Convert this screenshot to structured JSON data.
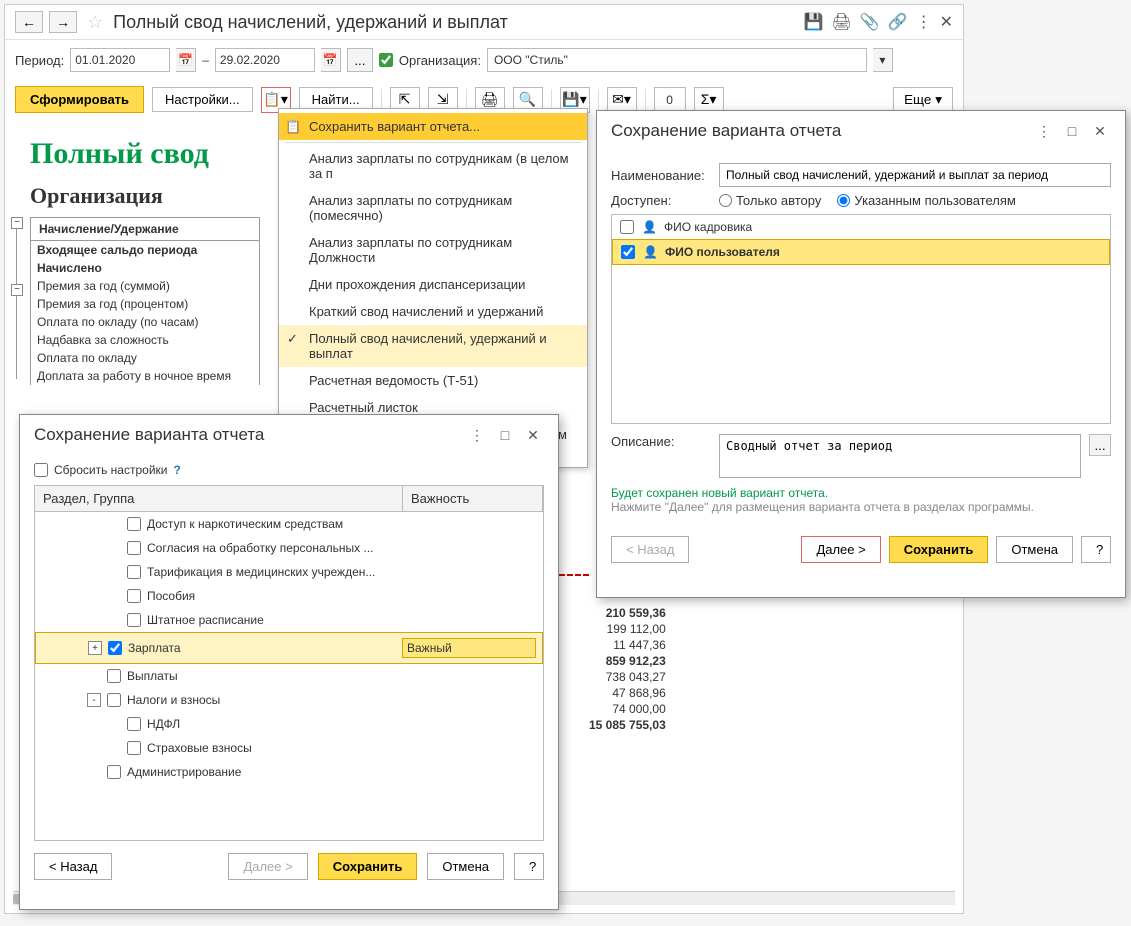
{
  "window": {
    "title": "Полный свод начислений, удержаний и выплат"
  },
  "period": {
    "label": "Период:",
    "from": "01.01.2020",
    "to": "29.02.2020",
    "sep": "–",
    "org_label": "Организация:",
    "org_value": "ООО \"Стиль\""
  },
  "toolbar": {
    "form": "Сформировать",
    "settings": "Настройки...",
    "find": "Найти...",
    "more": "Еще",
    "counter": "0"
  },
  "menu": {
    "save_variant": "Сохранить вариант отчета...",
    "items": [
      "Анализ зарплаты по сотрудникам (в целом за п",
      "Анализ зарплаты по сотрудникам (помесячно)",
      "Анализ зарплаты по сотрудникам Должности",
      "Дни прохождения диспансеризации",
      "Краткий свод начислений и удержаний",
      "Полный свод начислений, удержаний и выплат",
      "Расчетная ведомость (Т-51)",
      "Расчетный листок",
      "Расчетный листок с разбивкой по рабочим мест"
    ],
    "checked_index": 5
  },
  "report": {
    "title": "Полный свод",
    "org_label": "Организация",
    "header": "Начисление/Удержание",
    "rows": [
      {
        "text": "Входящее сальдо периода",
        "bold": true
      },
      {
        "text": "Начислено",
        "bold": true
      },
      {
        "text": "Премия за год (суммой)",
        "bold": false
      },
      {
        "text": "Премия за год (процентом)",
        "bold": false
      },
      {
        "text": "Оплата по окладу (по часам)",
        "bold": false
      },
      {
        "text": "Надбавка за сложность",
        "bold": false
      },
      {
        "text": "Оплата по окладу",
        "bold": false
      },
      {
        "text": "Доплата за работу в ночное время",
        "bold": false
      }
    ],
    "values": [
      {
        "v": "210 559,36",
        "bold": true
      },
      {
        "v": "199 112,00",
        "bold": false
      },
      {
        "v": "11 447,36",
        "bold": false
      },
      {
        "v": "859 912,23",
        "bold": true
      },
      {
        "v": "738 043,27",
        "bold": false
      },
      {
        "v": "47 868,96",
        "bold": false
      },
      {
        "v": "74 000,00",
        "bold": false
      },
      {
        "v": "15 085 755,03",
        "bold": true
      }
    ]
  },
  "dialog1": {
    "title": "Сохранение варианта отчета",
    "name_label": "Наименование:",
    "name_value": "Полный свод начислений, удержаний и выплат за период",
    "access_label": "Доступен:",
    "radio_author": "Только автору",
    "radio_users": "Указанным пользователям",
    "users": [
      {
        "name": "ФИО кадровика",
        "checked": false,
        "selected": false
      },
      {
        "name": "ФИО пользователя",
        "checked": true,
        "selected": true
      }
    ],
    "desc_label": "Описание:",
    "desc_value": "Сводный отчет за период",
    "info1": "Будет сохранен новый вариант отчета.",
    "info2": "Нажмите \"Далее\" для размещения варианта отчета в разделах программы.",
    "back": "< Назад",
    "next": "Далее >",
    "save": "Сохранить",
    "cancel": "Отмена",
    "help": "?"
  },
  "dialog2": {
    "title": "Сохранение варианта отчета",
    "reset": "Сбросить настройки",
    "help": "?",
    "col1": "Раздел, Группа",
    "col2": "Важность",
    "rows": [
      {
        "text": "Доступ к наркотическим средствам",
        "indent": 2,
        "checked": false,
        "exp": null,
        "importance": ""
      },
      {
        "text": "Согласия на обработку персональных ...",
        "indent": 2,
        "checked": false,
        "exp": null,
        "importance": ""
      },
      {
        "text": "Тарификация в медицинских учрежден...",
        "indent": 2,
        "checked": false,
        "exp": null,
        "importance": ""
      },
      {
        "text": "Пособия",
        "indent": 2,
        "checked": false,
        "exp": null,
        "importance": ""
      },
      {
        "text": "Штатное расписание",
        "indent": 2,
        "checked": false,
        "exp": null,
        "importance": ""
      },
      {
        "text": "Зарплата",
        "indent": 1,
        "checked": true,
        "exp": "+",
        "importance": "Важный",
        "selected": true
      },
      {
        "text": "Выплаты",
        "indent": 1,
        "checked": false,
        "exp": null,
        "importance": ""
      },
      {
        "text": "Налоги и взносы",
        "indent": 1,
        "checked": false,
        "exp": "-",
        "importance": ""
      },
      {
        "text": "НДФЛ",
        "indent": 2,
        "checked": false,
        "exp": null,
        "importance": ""
      },
      {
        "text": "Страховые взносы",
        "indent": 2,
        "checked": false,
        "exp": null,
        "importance": ""
      },
      {
        "text": "Администрирование",
        "indent": 1,
        "checked": false,
        "exp": null,
        "importance": ""
      }
    ],
    "back": "< Назад",
    "next": "Далее >",
    "save": "Сохранить",
    "cancel": "Отмена",
    "help_btn": "?"
  }
}
